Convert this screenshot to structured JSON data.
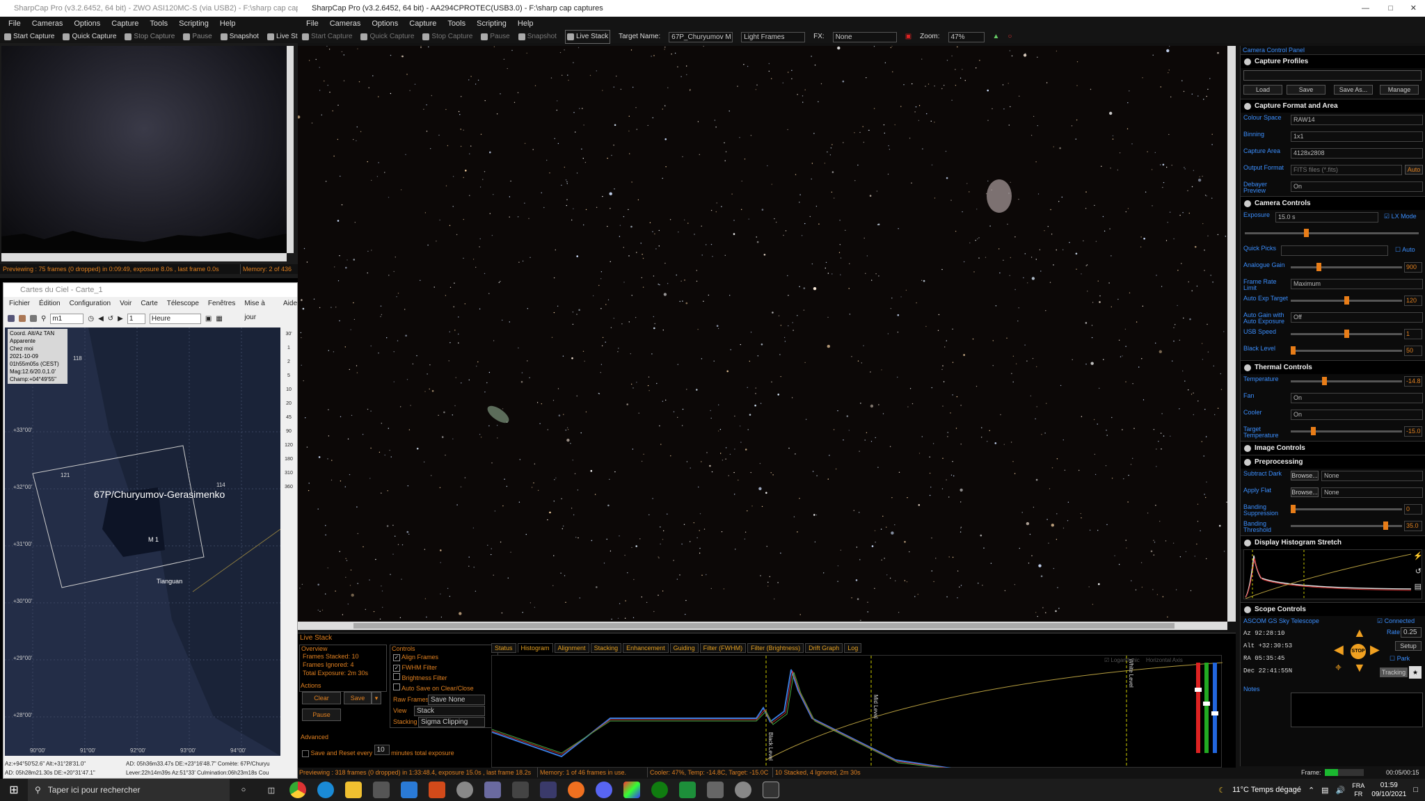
{
  "left_window": {
    "title": "SharpCap Pro (v3.2.6452, 64 bit) - ZWO ASI120MC-S (via USB2) - F:\\sharp cap captures",
    "menu": [
      "File",
      "Cameras",
      "Options",
      "Capture",
      "Tools",
      "Scripting",
      "Help"
    ],
    "toolbar": [
      "Start Capture",
      "Quick Capture",
      "Stop Capture",
      "Pause",
      "Snapshot",
      "Live Stack"
    ],
    "status": "Previewing : 75 frames (0 dropped) in 0:09:49, exposure 8.0s , last frame 0.0s",
    "memory": "Memory: 2 of 436"
  },
  "main_window": {
    "title": "SharpCap Pro (v3.2.6452, 64 bit) - AA294CPROTEC(USB3.0) - F:\\sharp cap captures",
    "menu": [
      "File",
      "Cameras",
      "Options",
      "Capture",
      "Tools",
      "Scripting",
      "Help"
    ],
    "toolbar": [
      "Start Capture",
      "Quick Capture",
      "Stop Capture",
      "Pause",
      "Snapshot",
      "Live Stack"
    ],
    "target_label": "Target Name:",
    "target_value": "67P_Churyumov M",
    "frame_type": "Light Frames",
    "fx_label": "FX:",
    "fx_value": "None",
    "zoom_label": "Zoom:",
    "zoom_value": "47%"
  },
  "ccp": {
    "title": "Camera Control Panel",
    "profiles": {
      "header": "Capture Profiles",
      "buttons": [
        "Load",
        "Save",
        "Save As...",
        "Manage"
      ]
    },
    "format": {
      "header": "Capture Format and Area",
      "rows": [
        {
          "label": "Colour Space",
          "value": "RAW14"
        },
        {
          "label": "Binning",
          "value": "1x1"
        },
        {
          "label": "Capture Area",
          "value": "4128x2808"
        },
        {
          "label": "Output Format",
          "value": "FITS files (*.fits)"
        },
        {
          "label": "Debayer Preview",
          "value": "On"
        }
      ],
      "auto": "Auto"
    },
    "camera": {
      "header": "Camera Controls",
      "exposure_label": "Exposure",
      "exposure_value": "15.0 s",
      "lx_mode": "LX Mode",
      "quick_picks": "Quick Picks",
      "auto": "Auto",
      "sliders": [
        {
          "label": "Analogue Gain",
          "value": "900",
          "pos": 0.25
        },
        {
          "label": "Frame Rate Limit",
          "value": "Maximum",
          "pos": null
        },
        {
          "label": "Auto Exp Target",
          "value": "120",
          "pos": 0.5
        },
        {
          "label": "Auto Gain with Auto Exposure",
          "value": "Off",
          "pos": null
        },
        {
          "label": "USB Speed",
          "value": "1",
          "pos": 0.5
        },
        {
          "label": "Black Level",
          "value": "50",
          "pos": 0.02
        }
      ]
    },
    "thermal": {
      "header": "Thermal Controls",
      "rows": [
        {
          "label": "Temperature",
          "value": "-14.8",
          "pos": 0.3
        },
        {
          "label": "Fan",
          "value": "On",
          "pos": null
        },
        {
          "label": "Cooler",
          "value": "On",
          "pos": null
        },
        {
          "label": "Target Temperature",
          "value": "-15.0",
          "pos": 0.2
        }
      ]
    },
    "image_header": "Image Controls",
    "pre": {
      "header": "Preprocessing",
      "subtract_dark": "Subtract Dark",
      "browse": "Browse...",
      "none": "None",
      "apply_flat": "Apply Flat",
      "banding_supp": "Banding Suppression",
      "banding_supp_val": "0",
      "banding_thr": "Banding Threshold",
      "banding_thr_val": "35.0"
    },
    "hist_header": "Display Histogram Stretch",
    "scope": {
      "header": "Scope Controls",
      "name": "ASCOM GS Sky Telescope",
      "connected": "Connected",
      "az": "Az   92:28:10",
      "alt": "Alt +32:30:53",
      "ra": "RA   05:35:45",
      "dec": "Dec  22:41:55N",
      "rate_label": "Rate:",
      "rate": "0.25",
      "setup": "Setup",
      "park": "Park",
      "tracking": "Tracking",
      "stop": "STOP"
    },
    "notes": "Notes",
    "frame_label": "Frame:",
    "frame_time": "00:05/00:15"
  },
  "live_stack": {
    "title": "Live Stack",
    "overview": "Overview",
    "stacked": "Frames Stacked: 10",
    "ignored": "Frames Ignored: 4",
    "total": "Total Exposure:   2m 30s",
    "actions": "Actions",
    "clear": "Clear",
    "save": "Save",
    "pause": "Pause",
    "advanced": "Advanced",
    "save_reset": "Save and Reset every",
    "save_reset_val": "10",
    "minutes": "minutes total exposure",
    "controls": "Controls",
    "checks": [
      "Align Frames",
      "FWHM Filter",
      "Brightness Filter",
      "Auto Save on Clear/Close"
    ],
    "raw_frames": "Raw Frames",
    "raw_val": "Save None",
    "view": "View",
    "view_val": "Stack",
    "stacking": "Stacking",
    "stacking_val": "Sigma Clipping",
    "tabs": [
      "Status",
      "Histogram",
      "Alignment",
      "Stacking",
      "Enhancement",
      "Guiding",
      "Filter (FWHM)",
      "Filter (Brightness)",
      "Drift Graph",
      "Log"
    ],
    "log": "Logarithmic",
    "hz": "Horizontal Axis",
    "black": "Black Level",
    "mid": "Mid Level",
    "white": "White Level"
  },
  "status_bar": {
    "preview": "Previewing : 318 frames (0 dropped) in 1:33:48.4, exposure 15.0s , last frame 18.2s",
    "memory": "Memory: 1 of 46 frames in use.",
    "cooler": "Cooler: 47%, Temp: -14.8C, Target: -15.0C",
    "stacked": "10 Stacked, 4 Ignored, 2m 30s"
  },
  "cdc": {
    "title": "Cartes du Ciel - Carte_1",
    "menu": [
      "Fichier",
      "Édition",
      "Configuration",
      "Voir",
      "Carte",
      "Télescope",
      "Fenêtres",
      "Mise à jour",
      "Aide"
    ],
    "search": "m1",
    "step": "1",
    "unit": "Heure",
    "info": [
      "Coord. Alt/Az TAN",
      "Apparente",
      "Chez moi",
      "2021-10-09",
      "01h55m05s (CEST)",
      "Mag:12.6/20.0,1.0'",
      "Champ:+04°49'55\""
    ],
    "target": "67P/Churyumov-Gerasimenko",
    "labels": {
      "m1": "M 1",
      "tianguan": "Tianguan",
      "i118": "118",
      "i121": "121",
      "i114": "114"
    },
    "dec": [
      "+33°00'",
      "+32°00'",
      "+31°00'",
      "+30°00'",
      "+29°00'",
      "+28°00'"
    ],
    "ra": [
      "90°00'",
      "91°00'",
      "92°00'",
      "93°00'",
      "94°00'"
    ],
    "scale": [
      "30'",
      "1",
      "2",
      "5",
      "10",
      "20",
      "45",
      "90",
      "120",
      "180",
      "310",
      "360"
    ],
    "status1": "Az:+94°50'52.6\" Alt:+31°28'31.0\"",
    "status2": "AD: 05h28m21.30s DE:+20°31'47.1\"",
    "status3": "AD: 05h36m33.47s DE:+23°16'48.7\"  Comète: 67P/Churyu",
    "status4": "Lever:22h14m39s Az:51°33'  Culmination:06h23m18s  Cou"
  },
  "taskbar": {
    "search": "Taper ici pour rechercher",
    "weather": "11°C  Temps dégagé",
    "lang1": "FRA",
    "lang2": "FR",
    "time": "01:59",
    "date": "09/10/2021"
  }
}
